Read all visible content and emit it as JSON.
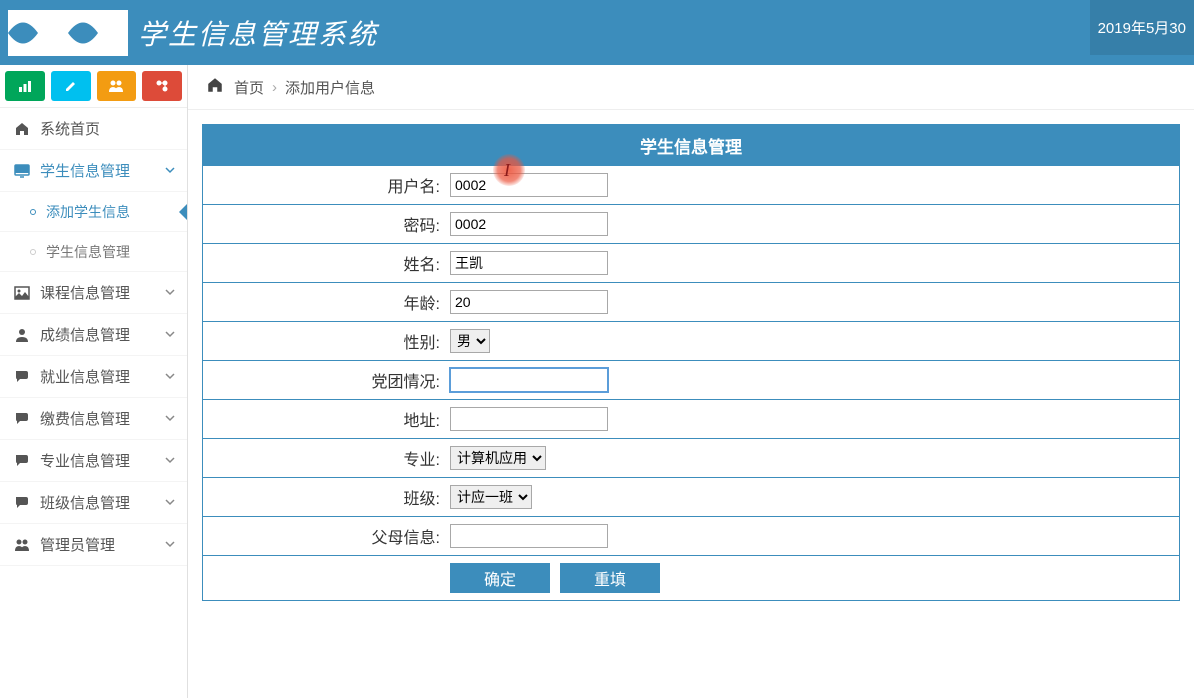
{
  "header": {
    "title": "学生信息管理系统",
    "date": "2019年5月30"
  },
  "sidebar": {
    "home": "系统首页",
    "items": [
      {
        "label": "学生信息管理",
        "expanded": true
      },
      {
        "label": "课程信息管理",
        "expanded": false
      },
      {
        "label": "成绩信息管理",
        "expanded": false
      },
      {
        "label": "就业信息管理",
        "expanded": false
      },
      {
        "label": "缴费信息管理",
        "expanded": false
      },
      {
        "label": "专业信息管理",
        "expanded": false
      },
      {
        "label": "班级信息管理",
        "expanded": false
      },
      {
        "label": "管理员管理",
        "expanded": false
      }
    ],
    "sub": [
      {
        "label": "添加学生信息",
        "active": true
      },
      {
        "label": "学生信息管理",
        "active": false
      }
    ]
  },
  "breadcrumb": {
    "home": "首页",
    "current": "添加用户信息"
  },
  "panel": {
    "title": "学生信息管理"
  },
  "form": {
    "username_label": "用户名:",
    "username_value": "0002",
    "password_label": "密码:",
    "password_value": "0002",
    "name_label": "姓名:",
    "name_value": "王凯",
    "age_label": "年龄:",
    "age_value": "20",
    "gender_label": "性别:",
    "gender_value": "男",
    "party_label": "党团情况:",
    "party_value": "",
    "address_label": "地址:",
    "address_value": "",
    "major_label": "专业:",
    "major_value": "计算机应用",
    "class_label": "班级:",
    "class_value": "计应一班",
    "parent_label": "父母信息:",
    "parent_value": "",
    "submit": "确定",
    "reset": "重填"
  }
}
